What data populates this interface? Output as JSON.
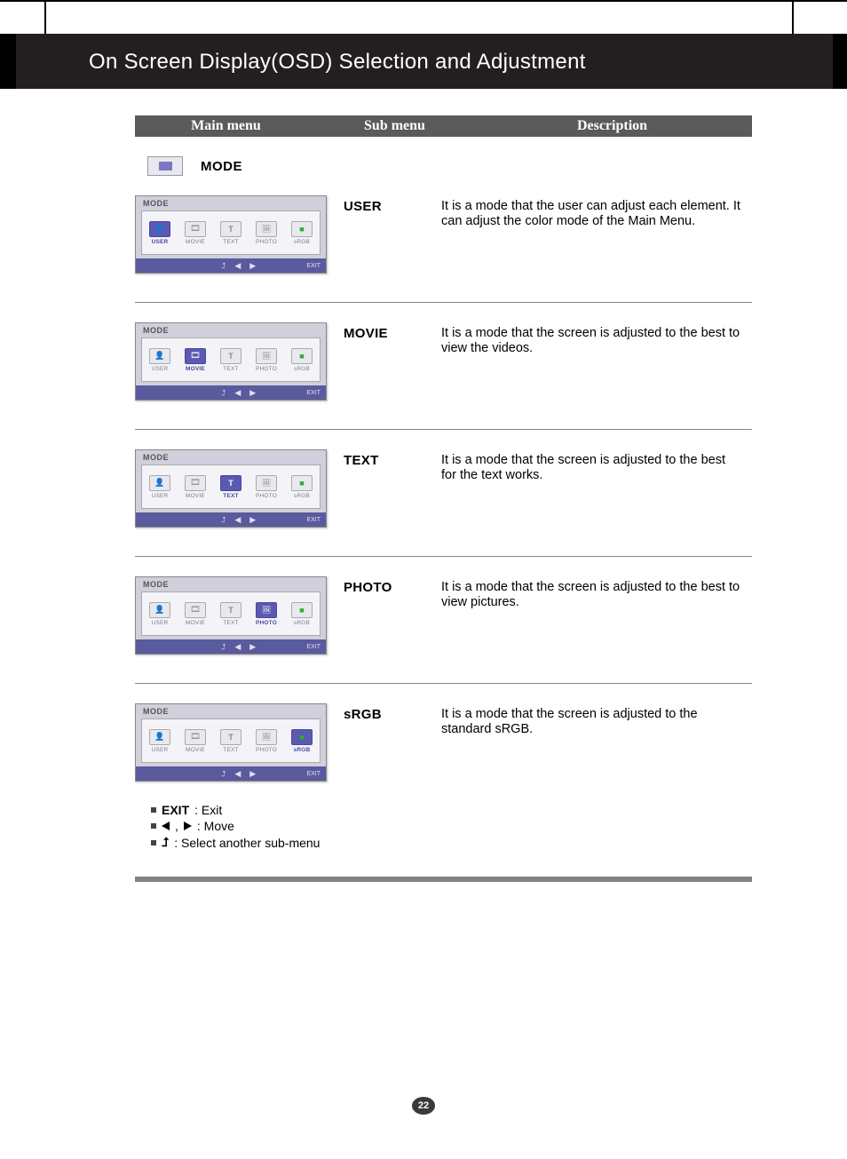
{
  "page": {
    "title": "On Screen Display(OSD) Selection and Adjustment",
    "number": "22"
  },
  "table_header": {
    "main": "Main menu",
    "sub": "Sub menu",
    "desc": "Description"
  },
  "mode_section": {
    "label": "MODE",
    "osd_title": "MODE",
    "osd_items": [
      {
        "key": "USER",
        "label": "USER"
      },
      {
        "key": "MOVIE",
        "label": "MOVIE"
      },
      {
        "key": "TEXT",
        "label": "TEXT"
      },
      {
        "key": "PHOTO",
        "label": "PHOTO"
      },
      {
        "key": "sRGB",
        "label": "sRGB"
      }
    ],
    "osd_exit": "EXIT",
    "rows": [
      {
        "sub": "USER",
        "desc": "It is a mode that the user can adjust each element. It can adjust the color mode of the Main Menu.",
        "selected": "USER"
      },
      {
        "sub": "MOVIE",
        "desc": "It is a mode that the screen is adjusted to the best to view the videos.",
        "selected": "MOVIE"
      },
      {
        "sub": "TEXT",
        "desc": "It is a mode that the screen is adjusted to the best for the text works.",
        "selected": "TEXT"
      },
      {
        "sub": "PHOTO",
        "desc": "It is a mode that the screen is adjusted to the best to view pictures.",
        "selected": "PHOTO"
      },
      {
        "sub": "sRGB",
        "desc": "It is a mode that the screen is adjusted to the standard sRGB.",
        "selected": "sRGB"
      }
    ]
  },
  "legend": {
    "exit_bold": "EXIT",
    "exit_text": ": Exit",
    "move_text": ": Move",
    "select_text": ": Select another sub-menu"
  }
}
